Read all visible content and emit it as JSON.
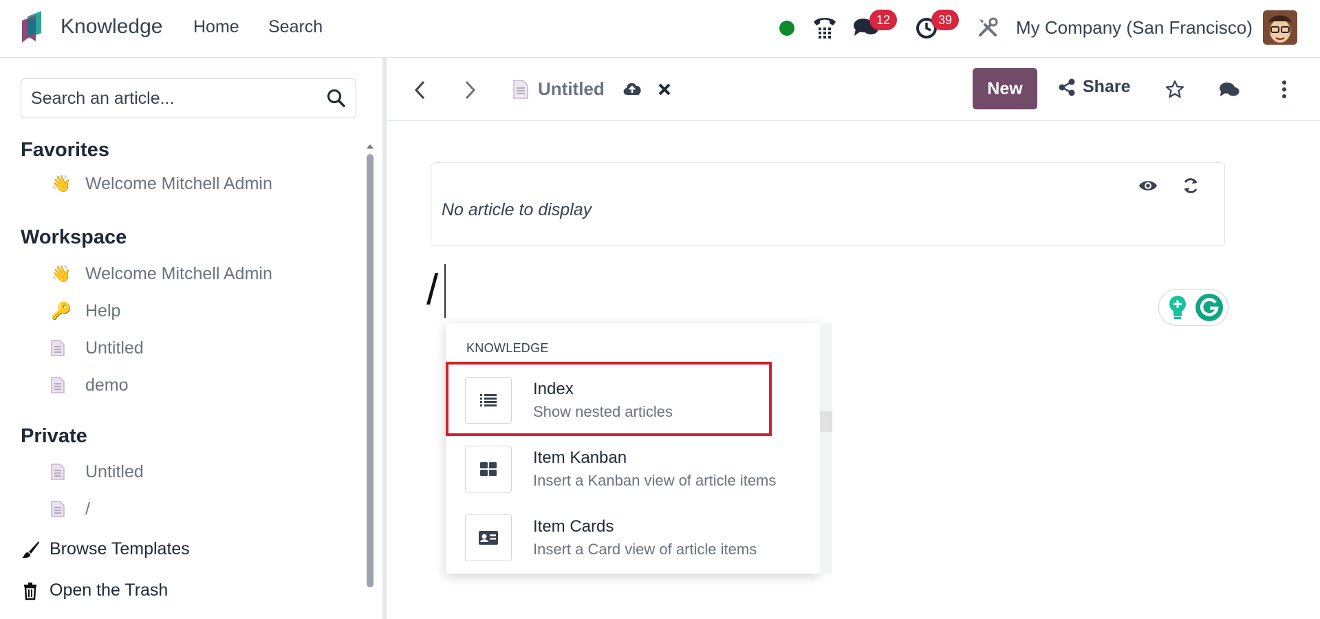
{
  "app": {
    "name": "Knowledge"
  },
  "nav": {
    "home": "Home",
    "search": "Search"
  },
  "systray": {
    "messages_count": "12",
    "activities_count": "39",
    "company": "My Company (San Francisco)"
  },
  "sidebar": {
    "search_placeholder": "Search an article...",
    "favorites": {
      "title": "Favorites",
      "items": [
        {
          "emoji": "👋",
          "label": "Welcome Mitchell Admin"
        }
      ]
    },
    "workspace": {
      "title": "Workspace",
      "items": [
        {
          "emoji": "👋",
          "label": "Welcome Mitchell Admin"
        },
        {
          "emoji": "🔑",
          "label": "Help"
        },
        {
          "icon": "document-icon",
          "label": "Untitled"
        },
        {
          "icon": "document-icon",
          "label": "demo"
        }
      ]
    },
    "private": {
      "title": "Private",
      "items": [
        {
          "icon": "document-icon",
          "label": "Untitled"
        },
        {
          "icon": "document-icon",
          "label": "/"
        }
      ]
    },
    "browse_templates": "Browse Templates",
    "open_trash": "Open the Trash"
  },
  "control_panel": {
    "article_title": "Untitled",
    "new_label": "New",
    "share_label": "Share"
  },
  "editor": {
    "embed_empty_text": "No article to display",
    "typed_text": "/"
  },
  "powerbox": {
    "category": "KNOWLEDGE",
    "commands": [
      {
        "name": "Index",
        "description": "Show nested articles",
        "icon": "list-icon"
      },
      {
        "name": "Item Kanban",
        "description": "Insert a Kanban view of article items",
        "icon": "kanban-icon"
      },
      {
        "name": "Item Cards",
        "description": "Insert a Card view of article items",
        "icon": "card-icon"
      }
    ]
  },
  "colors": {
    "brand": "#714b67",
    "badge": "#d7263d",
    "highlight": "#d1202f",
    "online": "#0f8a2e"
  }
}
